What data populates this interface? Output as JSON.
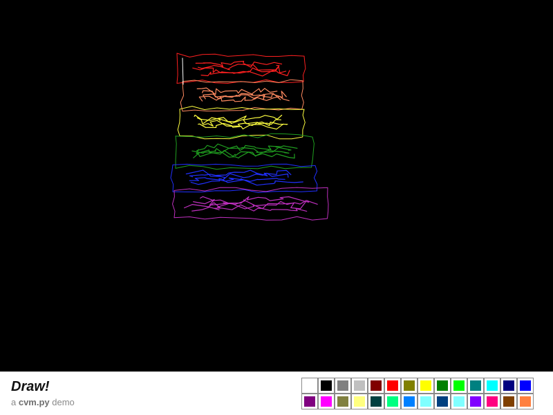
{
  "app": {
    "title": "Draw!",
    "subtitle_prefix": "a ",
    "subtitle_lib": "cvm.py",
    "subtitle_suffix": " demo"
  },
  "canvas": {
    "background": "#000000"
  },
  "palette": {
    "colors": [
      "#ffffff",
      "#000000",
      "#808080",
      "#c0c0c0",
      "#800000",
      "#ff0000",
      "#808000",
      "#ffff00",
      "#008000",
      "#00ff00",
      "#008080",
      "#00ffff",
      "#000080",
      "#0000ff",
      "#800080",
      "#ff00ff",
      "#808040",
      "#ffff80",
      "#004040",
      "#00ff80",
      "#0080ff",
      "#80ffff",
      "#004080",
      "#80ffff",
      "#8000ff",
      "#ff0080",
      "#804000",
      "#ff8040"
    ]
  }
}
